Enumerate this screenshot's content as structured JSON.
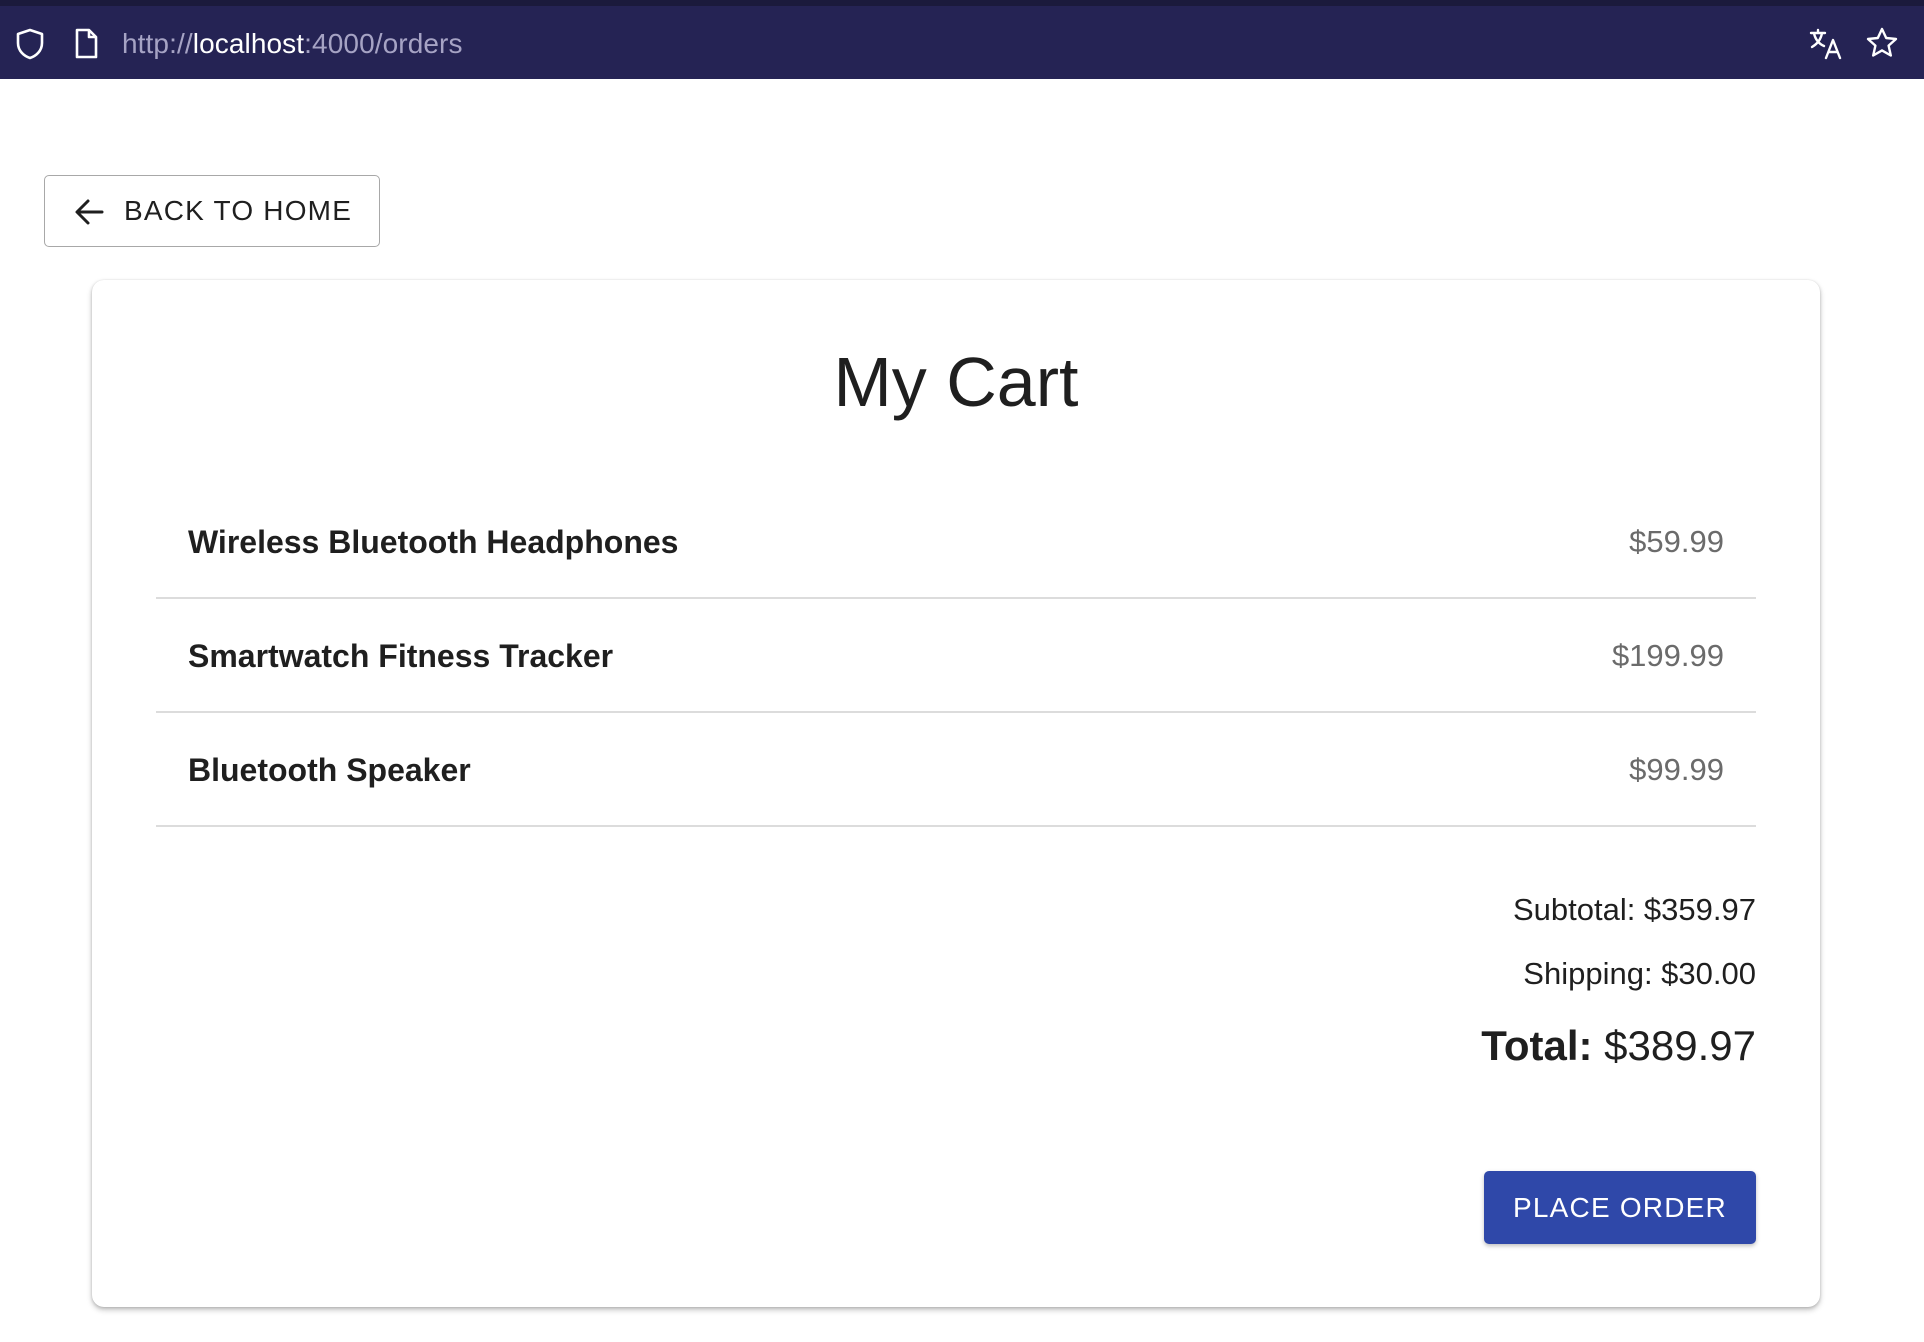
{
  "browser": {
    "url_prefix": "http://",
    "url_host": "localhost",
    "url_suffix": ":4000/orders",
    "icons": [
      "shield-icon",
      "page-icon",
      "translate-icon",
      "bookmark-star-icon"
    ]
  },
  "back_button": {
    "label": "BACK TO HOME",
    "icon": "arrow-left-icon"
  },
  "cart": {
    "title": "My Cart",
    "items": [
      {
        "name": "Wireless Bluetooth Headphones",
        "price": "$59.99"
      },
      {
        "name": "Smartwatch Fitness Tracker",
        "price": "$199.99"
      },
      {
        "name": "Bluetooth Speaker",
        "price": "$99.99"
      }
    ],
    "subtotal": "Subtotal: $359.97",
    "shipping": "Shipping: $30.00",
    "total_label": "Total:",
    "total_value": "$389.97",
    "place_order_label": "PLACE ORDER"
  },
  "colors": {
    "browser_bar": "#252354",
    "primary_button": "#2f48a9",
    "price_text": "#6b6b6b",
    "divider": "#dcdcdc"
  }
}
